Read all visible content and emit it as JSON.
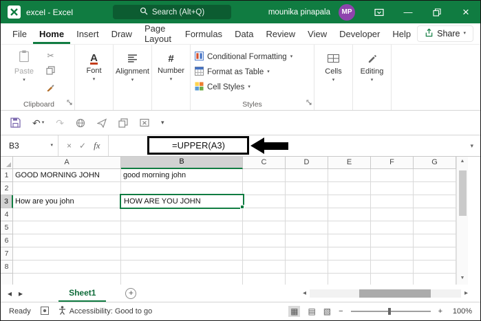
{
  "window": {
    "title": "excel  -  Excel"
  },
  "titlebar": {
    "search_placeholder": "Search (Alt+Q)",
    "user_name": "mounika pinapala",
    "user_initials": "MP"
  },
  "menubar": {
    "tabs": [
      "File",
      "Home",
      "Insert",
      "Draw",
      "Page Layout",
      "Formulas",
      "Data",
      "Review",
      "View",
      "Developer",
      "Help"
    ],
    "active_tab": "Home",
    "share": "Share"
  },
  "ribbon": {
    "paste": "Paste",
    "clipboard_group": "Clipboard",
    "font_group": "Font",
    "alignment_group": "Alignment",
    "number_group": "Number",
    "conditional_formatting": "Conditional Formatting",
    "format_as_table": "Format as Table",
    "cell_styles": "Cell Styles",
    "styles_group": "Styles",
    "cells_group": "Cells",
    "editing_group": "Editing"
  },
  "formula_bar": {
    "name_box": "B3",
    "fx": "fx",
    "formula": "=UPPER(A3)"
  },
  "grid": {
    "column_headers": [
      "A",
      "B",
      "C",
      "D",
      "E",
      "F",
      "G"
    ],
    "row_headers": [
      "1",
      "2",
      "3",
      "4",
      "5",
      "6",
      "7",
      "8"
    ],
    "selected_cell": "B3",
    "cells": {
      "A1": "GOOD MORNING JOHN",
      "B1": "good morning john",
      "A3": "How are you john",
      "B3": "HOW ARE YOU JOHN"
    }
  },
  "sheet_tabs": {
    "active_sheet": "Sheet1"
  },
  "status_bar": {
    "mode": "Ready",
    "accessibility": "Accessibility: Good to go",
    "zoom_level": "100%"
  },
  "icons": {
    "undo": "↶",
    "redo": "↷",
    "cut": "✂",
    "chevron_down": "▾",
    "close": "×",
    "minimize": "—",
    "left_arrow": "◂",
    "right_arrow": "▸",
    "up_arrow": "▲",
    "down_arrow": "▼",
    "cancel": "×",
    "check": "✓",
    "plus": "+",
    "view_normal": "▦",
    "view_page_layout": "▤",
    "view_page_break": "▧",
    "zoom_out": "−",
    "zoom_in": "+",
    "font_icon": "A",
    "number_icon": "#"
  },
  "colors": {
    "accent_green": "#107C41",
    "avatar_purple": "#8E44AD",
    "annotation_black": "#000000",
    "selected_header_gray": "#D2D2D2"
  }
}
